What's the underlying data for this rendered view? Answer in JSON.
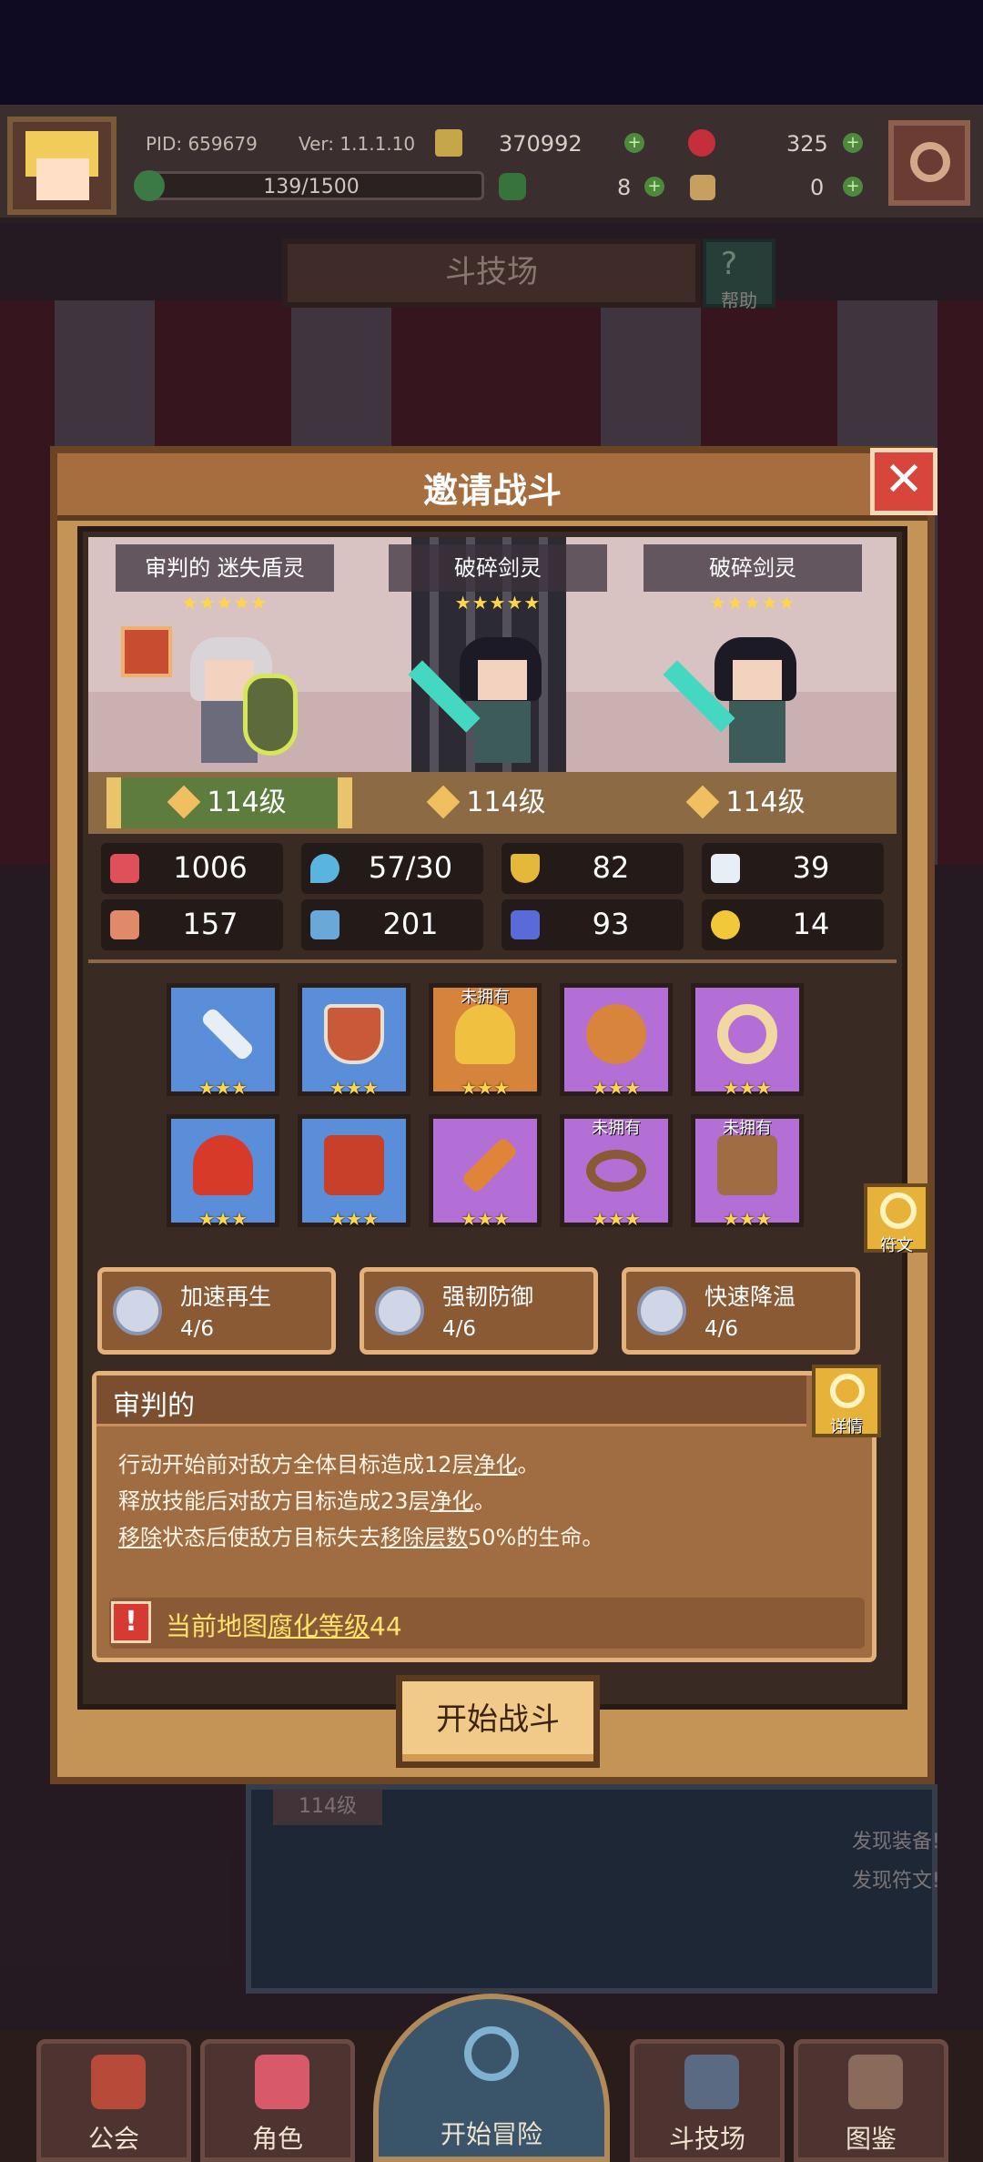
{
  "topbar": {
    "pid": "PID: 659679",
    "version": "Ver: 1.1.1.10",
    "gold": "370992",
    "gems": "325",
    "stamina": "139/1500",
    "clover": "8",
    "keys": "0",
    "plus_symbol": "+"
  },
  "arena": {
    "title": "斗技场",
    "help_label": "帮助"
  },
  "modal": {
    "title": "邀请战斗",
    "close_symbol": "✕",
    "units": [
      {
        "name": "审判的 迷失盾灵",
        "stars": "★★★★★",
        "level": "114级"
      },
      {
        "name": "破碎剑灵",
        "stars": "★★★★★",
        "level": "114级"
      },
      {
        "name": "破碎剑灵",
        "stars": "★★★★★",
        "level": "114级"
      }
    ],
    "stats": {
      "hp": "1006",
      "mana": "57/30",
      "defense": "82",
      "speed": "39",
      "attack": "157",
      "magic": "201",
      "resist": "93",
      "luck": "14"
    },
    "equipment": [
      {
        "icon": "sword-icon",
        "stars": "★★★",
        "not_owned": ""
      },
      {
        "icon": "shield-icon",
        "stars": "★★★",
        "not_owned": ""
      },
      {
        "icon": "necklace-icon",
        "stars": "★★★",
        "not_owned": "未拥有"
      },
      {
        "icon": "amulet-icon",
        "stars": "★★★",
        "not_owned": ""
      },
      {
        "icon": "ring-icon",
        "stars": "★★★",
        "not_owned": ""
      },
      {
        "icon": "helmet-icon",
        "stars": "★★★",
        "not_owned": ""
      },
      {
        "icon": "armor-icon",
        "stars": "★★★",
        "not_owned": ""
      },
      {
        "icon": "carrot-icon",
        "stars": "★★★",
        "not_owned": ""
      },
      {
        "icon": "belt-icon",
        "stars": "★★★",
        "not_owned": "未拥有"
      },
      {
        "icon": "boots-icon",
        "stars": "★★★",
        "not_owned": "未拥有"
      }
    ],
    "rune_label": "符文",
    "traits": [
      {
        "name": "加速再生",
        "progress": "4/6"
      },
      {
        "name": "强韧防御",
        "progress": "4/6"
      },
      {
        "name": "快速降温",
        "progress": "4/6"
      }
    ],
    "description": {
      "title": "审判的",
      "detail_label": "详情",
      "line1_a": "行动开始前对敌方全体目标造成12层",
      "line1_b": "净化",
      "line1_c": "。",
      "line2_a": "释放技能后对敌方目标造成23层",
      "line2_b": "净化",
      "line2_c": "。",
      "line3_a": "移除",
      "line3_b": "状态后使敌方目标失去",
      "line3_c": "移除层数",
      "line3_d": "50%的生命。",
      "warning_icon": "!",
      "warning_a": "当前地图",
      "warning_b": "腐化等级",
      "warning_c": "44"
    },
    "start_button": "开始战斗"
  },
  "background": {
    "level": "114级",
    "found_equipment": "发现装备!",
    "found_rune": "发现符文!"
  },
  "nav": {
    "guild": "公会",
    "character": "角色",
    "adventure": "开始冒险",
    "arena": "斗技场",
    "codex": "图鉴"
  }
}
